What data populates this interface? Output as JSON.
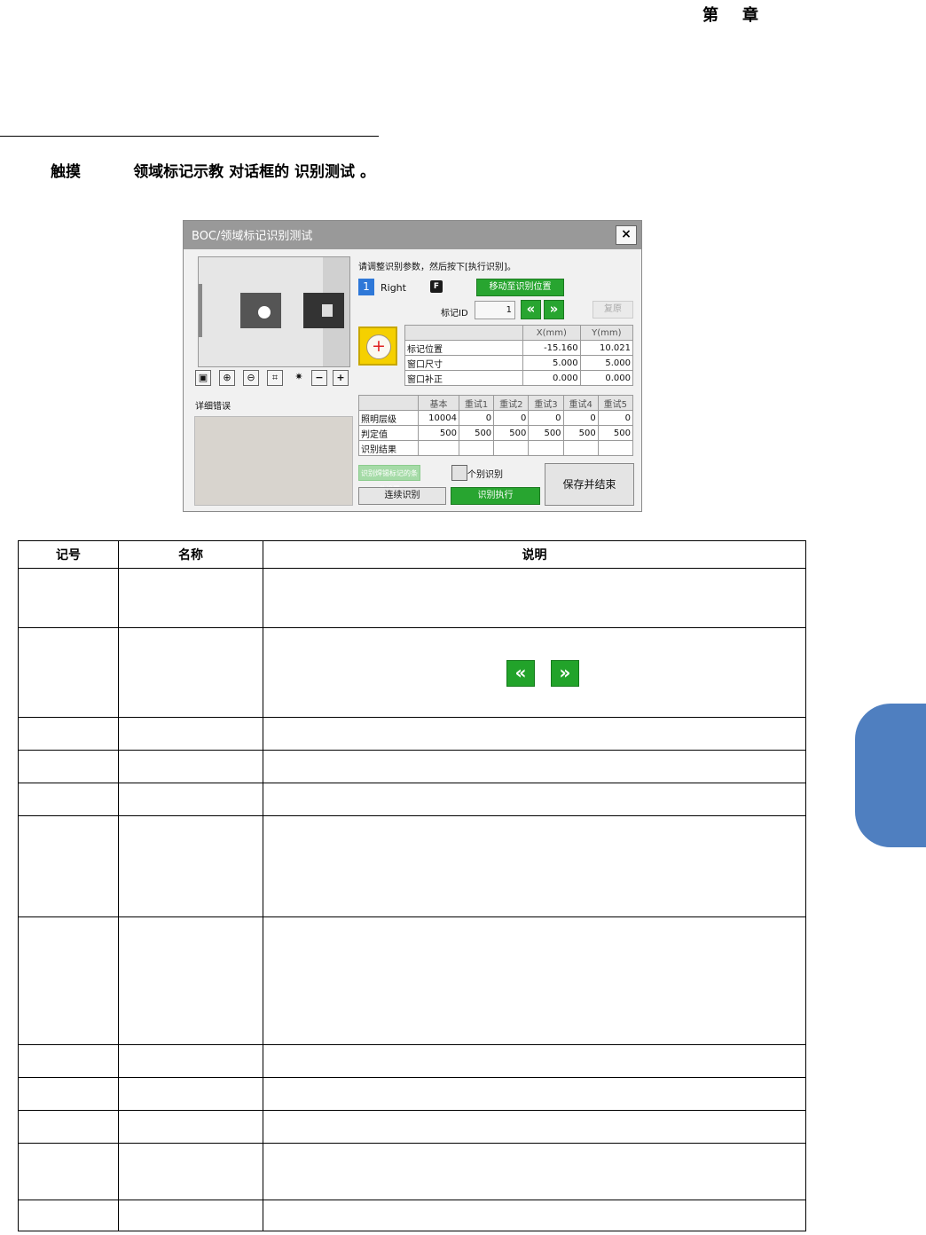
{
  "header": {
    "chapter_char1": "第",
    "chapter_char2": "章"
  },
  "instruction": {
    "part1": "触摸",
    "part2": "领域标记示教 对话框的 识别测试 。"
  },
  "dialog": {
    "title": "BOC/领域标记识别测试",
    "close": "×",
    "prompt": "请调整识别参数，然后按下[执行识别]。",
    "id_badge": "1",
    "side": "Right",
    "f_badge": "F",
    "move_button": "移动至识别位置",
    "mark_id_label": "标记ID",
    "mark_id_value": "1",
    "prev": "«",
    "next": "»",
    "restore": "复原",
    "error_label": "详细错误",
    "position_table": {
      "headers": [
        "",
        "X(mm)",
        "Y(mm)"
      ],
      "rows": [
        {
          "label": "标记位置",
          "x": "-15.160",
          "y": "10.021"
        },
        {
          "label": "窗口尺寸",
          "x": "5.000",
          "y": "5.000"
        },
        {
          "label": "窗口补正",
          "x": "0.000",
          "y": "0.000"
        }
      ]
    },
    "retry_table": {
      "headers": [
        "",
        "基本",
        "重试1",
        "重试2",
        "重试3",
        "重试4",
        "重试5"
      ],
      "rows": [
        {
          "label": "照明层级",
          "values": [
            "10004",
            "0",
            "0",
            "0",
            "0",
            "0"
          ]
        },
        {
          "label": "判定值",
          "values": [
            "500",
            "500",
            "500",
            "500",
            "500",
            "500"
          ]
        },
        {
          "label": "识别结果",
          "values": [
            "",
            "",
            "",
            "",
            "",
            ""
          ]
        }
      ]
    },
    "condition_button": "识别焊锡标记的条件设置",
    "individual_label": "个别识别",
    "continuous_button": "连续识别",
    "execute_button": "识别执行",
    "save_button": "保存并结束"
  },
  "doc_table": {
    "headers": [
      "记号",
      "名称",
      "说明"
    ]
  },
  "colors": {
    "green": "#28a530",
    "blue_badge": "#2e78d8",
    "yellow": "#f5d000",
    "side_tab": "#4f7fc0"
  }
}
